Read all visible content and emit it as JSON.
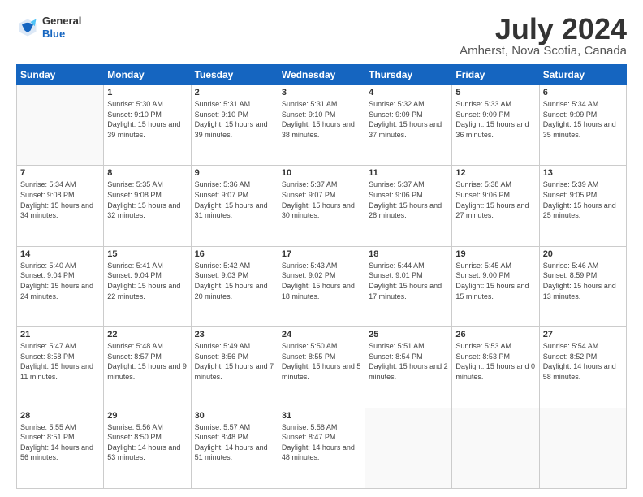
{
  "header": {
    "logo": {
      "general": "General",
      "blue": "Blue"
    },
    "title": "July 2024",
    "location": "Amherst, Nova Scotia, Canada"
  },
  "weekdays": [
    "Sunday",
    "Monday",
    "Tuesday",
    "Wednesday",
    "Thursday",
    "Friday",
    "Saturday"
  ],
  "weeks": [
    [
      {
        "day": "",
        "empty": true
      },
      {
        "day": "1",
        "sunrise": "Sunrise: 5:30 AM",
        "sunset": "Sunset: 9:10 PM",
        "daylight": "Daylight: 15 hours and 39 minutes."
      },
      {
        "day": "2",
        "sunrise": "Sunrise: 5:31 AM",
        "sunset": "Sunset: 9:10 PM",
        "daylight": "Daylight: 15 hours and 39 minutes."
      },
      {
        "day": "3",
        "sunrise": "Sunrise: 5:31 AM",
        "sunset": "Sunset: 9:10 PM",
        "daylight": "Daylight: 15 hours and 38 minutes."
      },
      {
        "day": "4",
        "sunrise": "Sunrise: 5:32 AM",
        "sunset": "Sunset: 9:09 PM",
        "daylight": "Daylight: 15 hours and 37 minutes."
      },
      {
        "day": "5",
        "sunrise": "Sunrise: 5:33 AM",
        "sunset": "Sunset: 9:09 PM",
        "daylight": "Daylight: 15 hours and 36 minutes."
      },
      {
        "day": "6",
        "sunrise": "Sunrise: 5:34 AM",
        "sunset": "Sunset: 9:09 PM",
        "daylight": "Daylight: 15 hours and 35 minutes."
      }
    ],
    [
      {
        "day": "7",
        "sunrise": "Sunrise: 5:34 AM",
        "sunset": "Sunset: 9:08 PM",
        "daylight": "Daylight: 15 hours and 34 minutes."
      },
      {
        "day": "8",
        "sunrise": "Sunrise: 5:35 AM",
        "sunset": "Sunset: 9:08 PM",
        "daylight": "Daylight: 15 hours and 32 minutes."
      },
      {
        "day": "9",
        "sunrise": "Sunrise: 5:36 AM",
        "sunset": "Sunset: 9:07 PM",
        "daylight": "Daylight: 15 hours and 31 minutes."
      },
      {
        "day": "10",
        "sunrise": "Sunrise: 5:37 AM",
        "sunset": "Sunset: 9:07 PM",
        "daylight": "Daylight: 15 hours and 30 minutes."
      },
      {
        "day": "11",
        "sunrise": "Sunrise: 5:37 AM",
        "sunset": "Sunset: 9:06 PM",
        "daylight": "Daylight: 15 hours and 28 minutes."
      },
      {
        "day": "12",
        "sunrise": "Sunrise: 5:38 AM",
        "sunset": "Sunset: 9:06 PM",
        "daylight": "Daylight: 15 hours and 27 minutes."
      },
      {
        "day": "13",
        "sunrise": "Sunrise: 5:39 AM",
        "sunset": "Sunset: 9:05 PM",
        "daylight": "Daylight: 15 hours and 25 minutes."
      }
    ],
    [
      {
        "day": "14",
        "sunrise": "Sunrise: 5:40 AM",
        "sunset": "Sunset: 9:04 PM",
        "daylight": "Daylight: 15 hours and 24 minutes."
      },
      {
        "day": "15",
        "sunrise": "Sunrise: 5:41 AM",
        "sunset": "Sunset: 9:04 PM",
        "daylight": "Daylight: 15 hours and 22 minutes."
      },
      {
        "day": "16",
        "sunrise": "Sunrise: 5:42 AM",
        "sunset": "Sunset: 9:03 PM",
        "daylight": "Daylight: 15 hours and 20 minutes."
      },
      {
        "day": "17",
        "sunrise": "Sunrise: 5:43 AM",
        "sunset": "Sunset: 9:02 PM",
        "daylight": "Daylight: 15 hours and 18 minutes."
      },
      {
        "day": "18",
        "sunrise": "Sunrise: 5:44 AM",
        "sunset": "Sunset: 9:01 PM",
        "daylight": "Daylight: 15 hours and 17 minutes."
      },
      {
        "day": "19",
        "sunrise": "Sunrise: 5:45 AM",
        "sunset": "Sunset: 9:00 PM",
        "daylight": "Daylight: 15 hours and 15 minutes."
      },
      {
        "day": "20",
        "sunrise": "Sunrise: 5:46 AM",
        "sunset": "Sunset: 8:59 PM",
        "daylight": "Daylight: 15 hours and 13 minutes."
      }
    ],
    [
      {
        "day": "21",
        "sunrise": "Sunrise: 5:47 AM",
        "sunset": "Sunset: 8:58 PM",
        "daylight": "Daylight: 15 hours and 11 minutes."
      },
      {
        "day": "22",
        "sunrise": "Sunrise: 5:48 AM",
        "sunset": "Sunset: 8:57 PM",
        "daylight": "Daylight: 15 hours and 9 minutes."
      },
      {
        "day": "23",
        "sunrise": "Sunrise: 5:49 AM",
        "sunset": "Sunset: 8:56 PM",
        "daylight": "Daylight: 15 hours and 7 minutes."
      },
      {
        "day": "24",
        "sunrise": "Sunrise: 5:50 AM",
        "sunset": "Sunset: 8:55 PM",
        "daylight": "Daylight: 15 hours and 5 minutes."
      },
      {
        "day": "25",
        "sunrise": "Sunrise: 5:51 AM",
        "sunset": "Sunset: 8:54 PM",
        "daylight": "Daylight: 15 hours and 2 minutes."
      },
      {
        "day": "26",
        "sunrise": "Sunrise: 5:53 AM",
        "sunset": "Sunset: 8:53 PM",
        "daylight": "Daylight: 15 hours and 0 minutes."
      },
      {
        "day": "27",
        "sunrise": "Sunrise: 5:54 AM",
        "sunset": "Sunset: 8:52 PM",
        "daylight": "Daylight: 14 hours and 58 minutes."
      }
    ],
    [
      {
        "day": "28",
        "sunrise": "Sunrise: 5:55 AM",
        "sunset": "Sunset: 8:51 PM",
        "daylight": "Daylight: 14 hours and 56 minutes."
      },
      {
        "day": "29",
        "sunrise": "Sunrise: 5:56 AM",
        "sunset": "Sunset: 8:50 PM",
        "daylight": "Daylight: 14 hours and 53 minutes."
      },
      {
        "day": "30",
        "sunrise": "Sunrise: 5:57 AM",
        "sunset": "Sunset: 8:48 PM",
        "daylight": "Daylight: 14 hours and 51 minutes."
      },
      {
        "day": "31",
        "sunrise": "Sunrise: 5:58 AM",
        "sunset": "Sunset: 8:47 PM",
        "daylight": "Daylight: 14 hours and 48 minutes."
      },
      {
        "day": "",
        "empty": true
      },
      {
        "day": "",
        "empty": true
      },
      {
        "day": "",
        "empty": true
      }
    ]
  ]
}
